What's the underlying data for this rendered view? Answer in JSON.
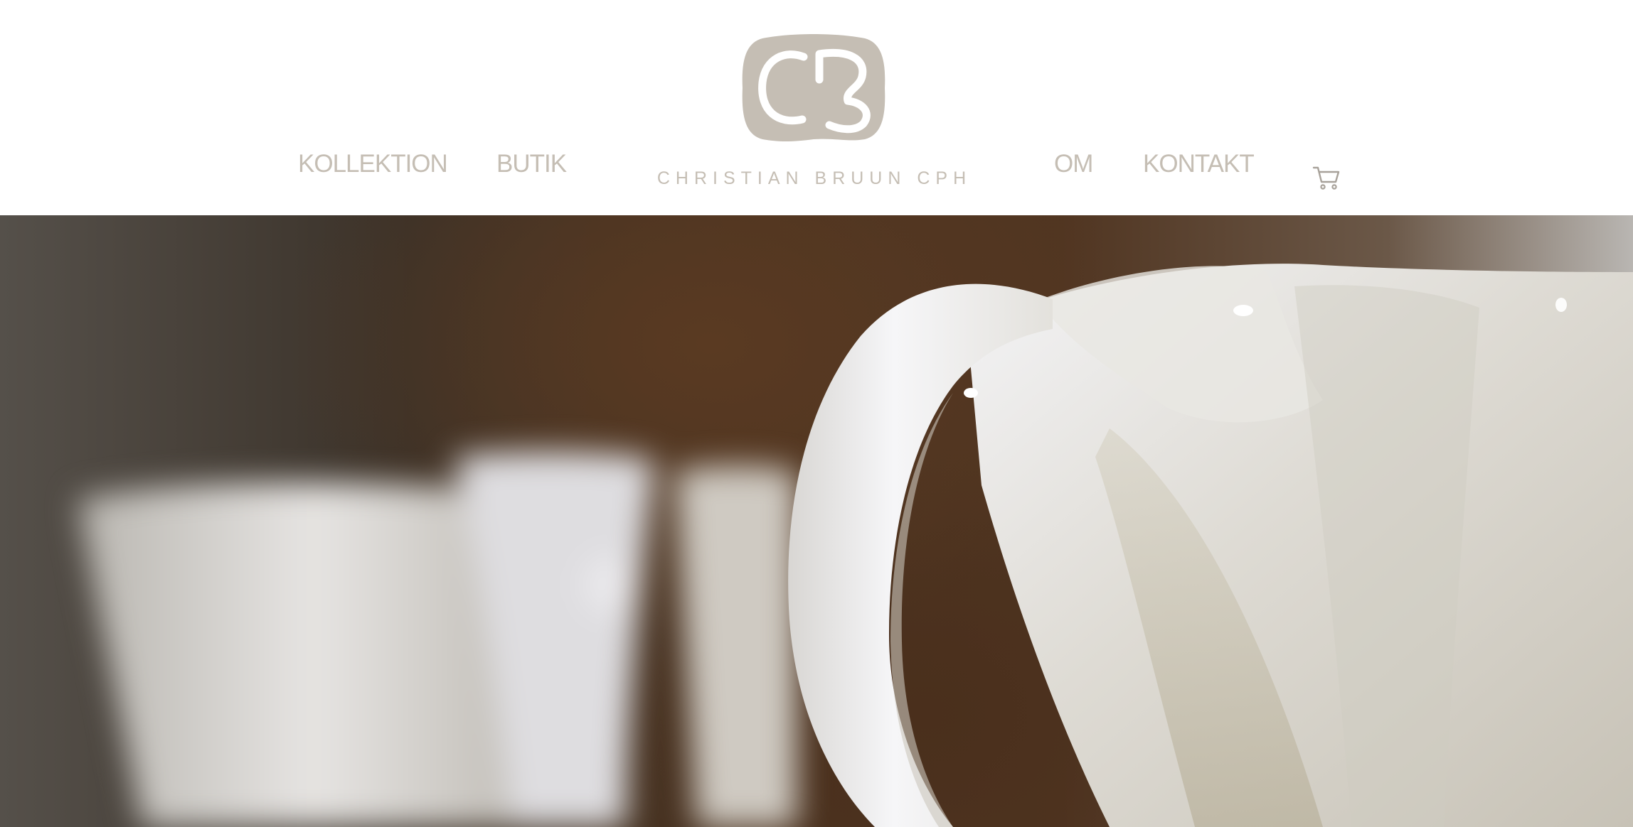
{
  "header": {
    "nav_left": [
      "KOLLEKTION",
      "BUTIK"
    ],
    "nav_right": [
      "OM",
      "KONTAKT"
    ],
    "brand_name": "CHRISTIAN BRUUN CPH",
    "logo_icon": "cb-monogram-icon",
    "cart_icon": "shopping-cart-icon"
  },
  "hero": {
    "image": "porcelain-cups-closeup"
  },
  "colors": {
    "nav_text": "#c5beb4",
    "logo_fill": "#c5beb4",
    "background": "#ffffff"
  }
}
